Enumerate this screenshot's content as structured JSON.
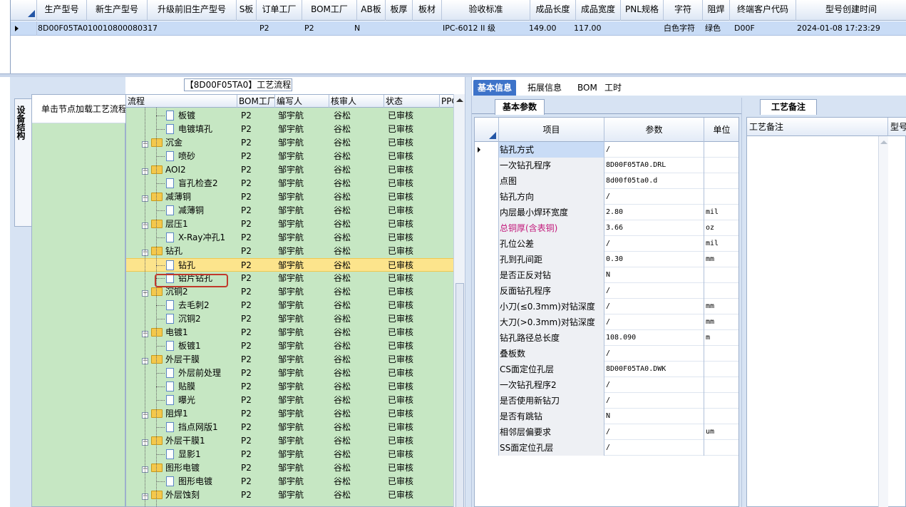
{
  "top_grid": {
    "columns": [
      "生产型号",
      "新生产型号",
      "升级前旧生产型号",
      "S板",
      "订单工厂",
      "BOM工厂",
      "AB板",
      "板厚",
      "板材",
      "验收标准",
      "成品长度",
      "成品宽度",
      "PNL规格",
      "字符",
      "阻焊",
      "终端客户代码",
      "型号创建时间"
    ],
    "row": [
      "8D00F05TA0",
      "10010800080317",
      "",
      "",
      "P2",
      "P2",
      "N",
      "",
      "",
      "IPC-6012 II 级",
      "149.00",
      "117.00",
      "",
      "白色字符",
      "绿色",
      "D00F",
      "2024-01-08 17:23:29"
    ]
  },
  "left_strip": {
    "vertical_tab": "设备结构",
    "panel_text": "单击节点加载工艺流程"
  },
  "flow_panel": {
    "title": "【8D00F05TA0】工艺流程",
    "columns": [
      "流程",
      "BOM工厂",
      "编写人",
      "核审人",
      "状态",
      "PPC"
    ],
    "rows": [
      {
        "name": "板镀",
        "level": 2,
        "type": "doc",
        "factory": "P2",
        "writer": "邹宇航",
        "reviewer": "谷松",
        "status": "已审核"
      },
      {
        "name": "电镀填孔",
        "level": 2,
        "type": "doc",
        "factory": "P2",
        "writer": "邹宇航",
        "reviewer": "谷松",
        "status": "已审核"
      },
      {
        "name": "沉金",
        "level": 1,
        "type": "folder",
        "factory": "P2",
        "writer": "邹宇航",
        "reviewer": "谷松",
        "status": "已审核"
      },
      {
        "name": "喷砂",
        "level": 2,
        "type": "doc",
        "factory": "P2",
        "writer": "邹宇航",
        "reviewer": "谷松",
        "status": "已审核"
      },
      {
        "name": "AOI2",
        "level": 1,
        "type": "folder",
        "factory": "P2",
        "writer": "邹宇航",
        "reviewer": "谷松",
        "status": "已审核"
      },
      {
        "name": "盲孔检查2",
        "level": 2,
        "type": "doc",
        "factory": "P2",
        "writer": "邹宇航",
        "reviewer": "谷松",
        "status": "已审核"
      },
      {
        "name": "减薄铜",
        "level": 1,
        "type": "folder",
        "factory": "P2",
        "writer": "邹宇航",
        "reviewer": "谷松",
        "status": "已审核"
      },
      {
        "name": "减薄铜",
        "level": 2,
        "type": "doc",
        "factory": "P2",
        "writer": "邹宇航",
        "reviewer": "谷松",
        "status": "已审核"
      },
      {
        "name": "层压1",
        "level": 1,
        "type": "folder",
        "factory": "P2",
        "writer": "邹宇航",
        "reviewer": "谷松",
        "status": "已审核"
      },
      {
        "name": "X-Ray冲孔1",
        "level": 2,
        "type": "doc",
        "factory": "P2",
        "writer": "邹宇航",
        "reviewer": "谷松",
        "status": "已审核"
      },
      {
        "name": "钻孔",
        "level": 1,
        "type": "folder",
        "factory": "P2",
        "writer": "邹宇航",
        "reviewer": "谷松",
        "status": "已审核"
      },
      {
        "name": "钻孔",
        "level": 2,
        "type": "doc",
        "factory": "P2",
        "writer": "邹宇航",
        "reviewer": "谷松",
        "status": "已审核",
        "selected": true
      },
      {
        "name": "铝片钻孔",
        "level": 2,
        "type": "doc",
        "factory": "P2",
        "writer": "邹宇航",
        "reviewer": "谷松",
        "status": "已审核"
      },
      {
        "name": "沉铜2",
        "level": 1,
        "type": "folder",
        "factory": "P2",
        "writer": "邹宇航",
        "reviewer": "谷松",
        "status": "已审核"
      },
      {
        "name": "去毛刺2",
        "level": 2,
        "type": "doc",
        "factory": "P2",
        "writer": "邹宇航",
        "reviewer": "谷松",
        "status": "已审核"
      },
      {
        "name": "沉铜2",
        "level": 2,
        "type": "doc",
        "factory": "P2",
        "writer": "邹宇航",
        "reviewer": "谷松",
        "status": "已审核"
      },
      {
        "name": "电镀1",
        "level": 1,
        "type": "folder",
        "factory": "P2",
        "writer": "邹宇航",
        "reviewer": "谷松",
        "status": "已审核"
      },
      {
        "name": "板镀1",
        "level": 2,
        "type": "doc",
        "factory": "P2",
        "writer": "邹宇航",
        "reviewer": "谷松",
        "status": "已审核"
      },
      {
        "name": "外层干膜",
        "level": 1,
        "type": "folder",
        "factory": "P2",
        "writer": "邹宇航",
        "reviewer": "谷松",
        "status": "已审核"
      },
      {
        "name": "外层前处理",
        "level": 2,
        "type": "doc",
        "factory": "P2",
        "writer": "邹宇航",
        "reviewer": "谷松",
        "status": "已审核"
      },
      {
        "name": "贴膜",
        "level": 2,
        "type": "doc",
        "factory": "P2",
        "writer": "邹宇航",
        "reviewer": "谷松",
        "status": "已审核"
      },
      {
        "name": "曝光",
        "level": 2,
        "type": "doc",
        "factory": "P2",
        "writer": "邹宇航",
        "reviewer": "谷松",
        "status": "已审核"
      },
      {
        "name": "阻焊1",
        "level": 1,
        "type": "folder",
        "factory": "P2",
        "writer": "邹宇航",
        "reviewer": "谷松",
        "status": "已审核"
      },
      {
        "name": "挡点网版1",
        "level": 2,
        "type": "doc",
        "factory": "P2",
        "writer": "邹宇航",
        "reviewer": "谷松",
        "status": "已审核"
      },
      {
        "name": "外层干膜1",
        "level": 1,
        "type": "folder",
        "factory": "P2",
        "writer": "邹宇航",
        "reviewer": "谷松",
        "status": "已审核"
      },
      {
        "name": "显影1",
        "level": 2,
        "type": "doc",
        "factory": "P2",
        "writer": "邹宇航",
        "reviewer": "谷松",
        "status": "已审核"
      },
      {
        "name": "图形电镀",
        "level": 1,
        "type": "folder",
        "factory": "P2",
        "writer": "邹宇航",
        "reviewer": "谷松",
        "status": "已审核"
      },
      {
        "name": "图形电镀",
        "level": 2,
        "type": "doc",
        "factory": "P2",
        "writer": "邹宇航",
        "reviewer": "谷松",
        "status": "已审核"
      },
      {
        "name": "外层蚀刻",
        "level": 1,
        "type": "folder",
        "factory": "P2",
        "writer": "邹宇航",
        "reviewer": "谷松",
        "status": "已审核"
      }
    ]
  },
  "right_tabs": [
    "基本信息",
    "拓展信息",
    "BOM",
    "工时"
  ],
  "param_panel": {
    "tab_label": "基本参数",
    "columns": [
      "项目",
      "参数",
      "单位"
    ],
    "rows": [
      {
        "name": "钻孔方式",
        "value": "/",
        "unit": ""
      },
      {
        "name": "一次钻孔程序",
        "value": "8D00F05TA0.DRL",
        "unit": ""
      },
      {
        "name": "点图",
        "value": "8d00f05ta0.d",
        "unit": ""
      },
      {
        "name": "钻孔方向",
        "value": "/",
        "unit": ""
      },
      {
        "name": "内层最小焊环宽度",
        "value": "2.80",
        "unit": "mil"
      },
      {
        "name": "总铜厚(含表铜)",
        "value": "3.66",
        "unit": "oz",
        "highlight": true
      },
      {
        "name": "孔位公差",
        "value": "/",
        "unit": "mil"
      },
      {
        "name": "孔到孔间距",
        "value": "0.30",
        "unit": "mm"
      },
      {
        "name": "是否正反对钻",
        "value": "N",
        "unit": ""
      },
      {
        "name": "反面钻孔程序",
        "value": "/",
        "unit": ""
      },
      {
        "name": "小刀(≤0.3mm)对钻深度",
        "value": "/",
        "unit": "mm"
      },
      {
        "name": "大刀(>0.3mm)对钻深度",
        "value": "/",
        "unit": "mm"
      },
      {
        "name": "钻孔路径总长度",
        "value": "108.090",
        "unit": "m"
      },
      {
        "name": "叠板数",
        "value": "/",
        "unit": ""
      },
      {
        "name": "CS面定位孔层",
        "value": "8D00F05TA0.DWK",
        "unit": ""
      },
      {
        "name": "一次钻孔程序2",
        "value": "/",
        "unit": ""
      },
      {
        "name": "是否使用新钻刀",
        "value": "/",
        "unit": ""
      },
      {
        "name": "是否有跳钻",
        "value": "N",
        "unit": ""
      },
      {
        "name": "相邻层偏要求",
        "value": "/",
        "unit": "um"
      },
      {
        "name": "SS面定位孔层",
        "value": "/",
        "unit": ""
      }
    ]
  },
  "remark_panel": {
    "tab_label": "工艺备注",
    "columns": [
      "工艺备注",
      "型号"
    ]
  }
}
